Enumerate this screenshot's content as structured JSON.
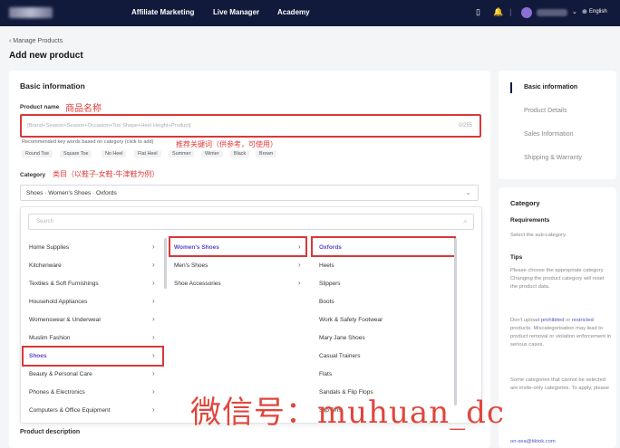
{
  "topbar": {
    "nav": [
      "Affiliate Marketing",
      "Live Manager",
      "Academy"
    ],
    "language": "English"
  },
  "breadcrumb": "Manage Products",
  "page_title": "Add new product",
  "basic_info": {
    "title": "Basic information",
    "product_name_label": "Product name",
    "product_name_annotation": "商品名称",
    "product_name_placeholder": "[Brand+Season+Season+Occasion+Toe Shape+Heel Height+Product]",
    "counter": "0/255",
    "hint": "Recommended key words based on category (click to add)",
    "hint_annotation": "推荐关键词（供参考，可使用）",
    "keywords": [
      "Round Toe",
      "Square Toe",
      "No Heel",
      "Flat Heel",
      "Summer",
      "Winter",
      "Black",
      "Brown"
    ],
    "category_label": "Category",
    "category_annotation": "类目（以鞋子-女鞋-牛津鞋为例）",
    "category_value": "Shoes · Women's Shoes · Oxfords",
    "search_placeholder": "Search",
    "col1": [
      "Home Supplies",
      "Kitchenware",
      "Textiles & Soft Furnishings",
      "Household Appliances",
      "Womenswear & Underwear",
      "Muslim Fashion",
      "Shoes",
      "Beauty & Personal Care",
      "Phones & Electronics",
      "Computers & Office Equipment"
    ],
    "col2": [
      "Women's Shoes",
      "Men's Shoes",
      "Shoe Accessories"
    ],
    "col3": [
      "Oxfords",
      "Heels",
      "Slippers",
      "Boots",
      "Work & Safety Footwear",
      "Mary Jane Shoes",
      "Casual Trainers",
      "Flats",
      "Sandals & Flip Flops",
      "Slip Ons"
    ],
    "description_label": "Product description"
  },
  "side_nav": [
    "Basic information",
    "Product Details",
    "Sales Information",
    "Shipping & Warranty"
  ],
  "tips": {
    "title": "Category",
    "requirements_label": "Requirements",
    "requirements_text": "Select the sub-category.",
    "tips_label": "Tips",
    "tip1": "Please choose the appropriate category. Changing the product category will reset the product data.",
    "tip2_pre": "Don't upload",
    "tip2_link1": "prohibited",
    "tip2_mid": "or",
    "tip2_link2": "restricted",
    "tip2_post": "products. Miscategorisation may lead to product removal or violation enforcement in serious cases.",
    "tip3": "Some categories that cannot be selected are invite-only categories. To apply, please",
    "tip3_email": "on-sea@tiktok.com"
  },
  "watermark": "微信号：muhuan_dc",
  "colors": {
    "accent": "#5b47c9",
    "topbar": "#121a3b",
    "annotation": "#e23a3a"
  }
}
